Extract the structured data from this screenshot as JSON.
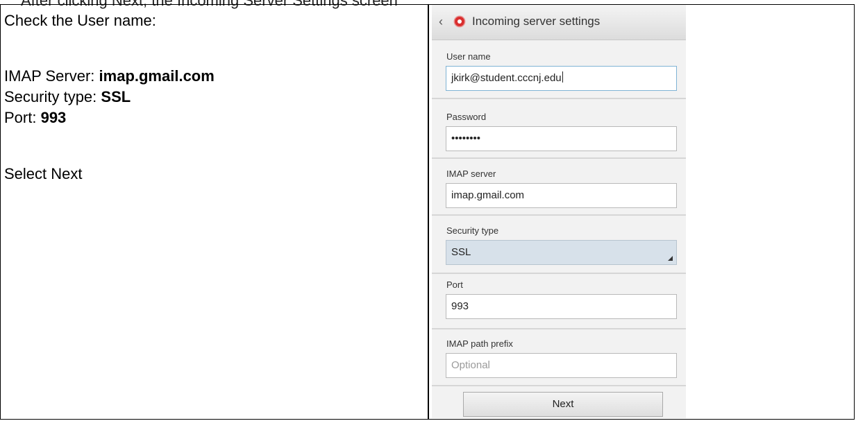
{
  "clipped_header_text": "After clicking Next, the Incoming Server Settings screen",
  "instructions": {
    "line1": "Check the User name:",
    "imap_server_label": "IMAP Server: ",
    "imap_server_value": "imap.gmail.com",
    "security_type_label": "Security type: ",
    "security_type_value": "SSL",
    "port_label": "Port: ",
    "port_value": "993",
    "select_next": "Select Next"
  },
  "phone": {
    "title": "Incoming server settings",
    "back_icon": "chevron-left-icon",
    "app_icon": "email-app-icon",
    "fields": {
      "username": {
        "label": "User name",
        "value": "jkirk@student.cccnj.edu"
      },
      "password": {
        "label": "Password",
        "value": "••••••••"
      },
      "imap_server": {
        "label": "IMAP server",
        "value": "imap.gmail.com"
      },
      "security_type": {
        "label": "Security type",
        "value": "SSL"
      },
      "port": {
        "label": "Port",
        "value": "993"
      },
      "imap_path_prefix": {
        "label": "IMAP path prefix",
        "placeholder": "Optional"
      }
    },
    "next_label": "Next"
  }
}
